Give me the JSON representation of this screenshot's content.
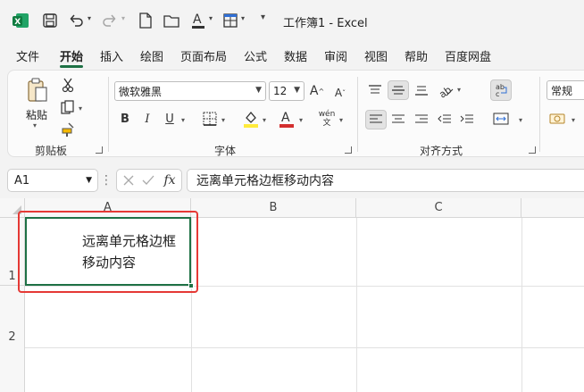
{
  "window": {
    "title": "工作簿1  -  Excel"
  },
  "menu_tabs": [
    "文件",
    "开始",
    "插入",
    "绘图",
    "页面布局",
    "公式",
    "数据",
    "审阅",
    "视图",
    "帮助",
    "百度网盘"
  ],
  "active_tab": "开始",
  "ribbon": {
    "clipboard": {
      "label": "剪贴板",
      "paste_label": "粘贴"
    },
    "font": {
      "label": "字体",
      "font_name": "微软雅黑",
      "font_size": "12",
      "bold": "B",
      "italic": "I",
      "underline": "U",
      "phonetic": "wén\n文"
    },
    "alignment": {
      "label": "对齐方式"
    },
    "number": {
      "format": "常规"
    }
  },
  "formula_bar": {
    "name_box": "A1",
    "content": "远离单元格边框移动内容",
    "fx": "fx"
  },
  "grid": {
    "columns": [
      "A",
      "B",
      "C"
    ],
    "rows": [
      "1",
      "2"
    ],
    "cell_a1_text": "远离单元格边框\n移动内容"
  },
  "colors": {
    "accent": "#1e7145",
    "highlight_border": "#e53935",
    "font_color_bar": "#d32f2f",
    "fill_color_bar": "#ffeb3b"
  }
}
